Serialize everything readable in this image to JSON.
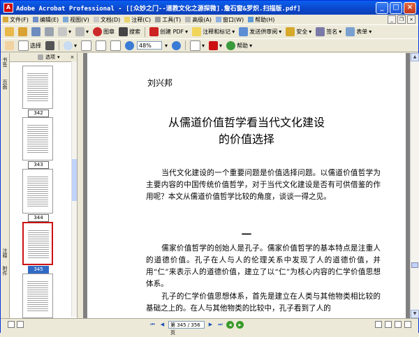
{
  "window": {
    "title": "Adobe Acrobat Professional - [[众妙之门--道教文化之源探微].詹石窗&罗炽.扫描版.pdf]",
    "app_icon": "A",
    "minimize": "_",
    "maximize": "□",
    "close": "×"
  },
  "menu": [
    {
      "label": "文件(F)",
      "icon": "file-icon"
    },
    {
      "label": "编辑(E)",
      "icon": "edit-icon"
    },
    {
      "label": "视图(V)",
      "icon": "view-icon"
    },
    {
      "label": "文档(D)",
      "icon": "document-icon"
    },
    {
      "label": "注释(C)",
      "icon": "comment-icon"
    },
    {
      "label": "工具(T)",
      "icon": "tools-icon"
    },
    {
      "label": "高级(A)",
      "icon": "advanced-icon"
    },
    {
      "label": "窗口(W)",
      "icon": "window-icon"
    },
    {
      "label": "帮助(H)",
      "icon": "help-icon"
    }
  ],
  "toolbar1": {
    "search_label": "搜索",
    "create_pdf": "创建 PDF",
    "comment_markup": "注释和标记",
    "send_review": "发送供审阅",
    "secure": "安全",
    "sign": "签名",
    "forms": "表单"
  },
  "toolbar2": {
    "select_label": "选择",
    "zoom_value": "48%",
    "help_label": "帮助"
  },
  "nav": {
    "bookmarks_tab": "书签",
    "pages_tab": "页面",
    "comments_tab": "注释",
    "attachments_tab": "附件",
    "options_label": "选项",
    "thumbnails": [
      {
        "label": "342"
      },
      {
        "label": "343"
      },
      {
        "label": "344"
      },
      {
        "label": "345"
      },
      {
        "label": ""
      }
    ]
  },
  "page": {
    "author": "刘兴邦",
    "title_line1": "从儒道价值哲学看当代文化建设",
    "title_line2": "的价值选择",
    "para1": "当代文化建设的一个重要问题是价值选择问题。以儒道价值哲学为主要内容的中国传统价值哲学，对于当代文化建设是否有可供借鉴的作用呢？本文从儒道价值哲学比较的角度，谈谈一得之见。",
    "section": "一",
    "para2": "儒家价值哲学的创始人是孔子。儒家价值哲学的基本特点是注重人的道德价值。孔子在人与人的伦理关系中发现了人的道德价值，并用“仁”来表示人的道德价值，建立了以“仁”为核心内容的仁学价值思想体系。",
    "para3": "孔子的仁学价值思想体系，首先是建立在人类与其他物类相比较的基础之上的。在人与其他物类的比较中，孔子看到了人的"
  },
  "status": {
    "page_field": "第 345 / 356 页"
  },
  "colors": {
    "titlebar": "#0c46c8",
    "selected_thumb_border": "#cc1111",
    "selected_label_bg": "#316ac5"
  }
}
